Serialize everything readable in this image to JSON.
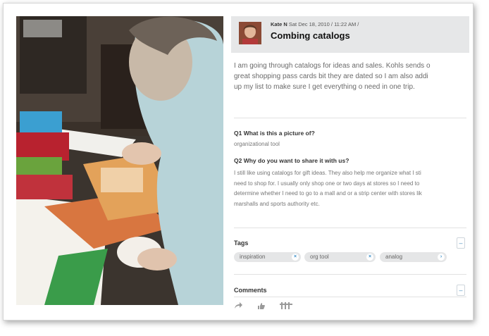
{
  "post": {
    "author": "Kate N",
    "date": "Sat Dec 18, 2010 / 11:22 AM /",
    "title": "Combing catalogs",
    "description": "I am going through catalogs for ideas and sales. Kohls sends o\ngreat shopping pass cards bit they are dated so I am also addi\nup my list to make sure I get everything o need in one trip."
  },
  "questions": [
    {
      "question": "Q1 What is this a picture of?",
      "answer": "organizational tool"
    },
    {
      "question": "Q2 Why do you want to share it with us?",
      "answer": "I still like using catalogs for gift ideas. They also help me organize what I sti\nneed to shop for. I usually only shop one or two days at stores so I need to\ndetermine whether I need to go to a mall and or a strip center with stores lik\nmarshalls and sports authority etc."
    }
  ],
  "tags": {
    "label": "Tags",
    "items": [
      {
        "label": "inspiration",
        "action": "×"
      },
      {
        "label": "org tool",
        "action": "×"
      },
      {
        "label": "analog",
        "action": "›"
      }
    ]
  },
  "comments": {
    "label": "Comments"
  },
  "collapse_glyph": "–",
  "toolbar_icons": [
    "share-icon",
    "thumbs-up-icon",
    "grid-icon"
  ],
  "colors": {
    "accent": "#3b8ec8",
    "header_bg": "#e6e7e8"
  }
}
